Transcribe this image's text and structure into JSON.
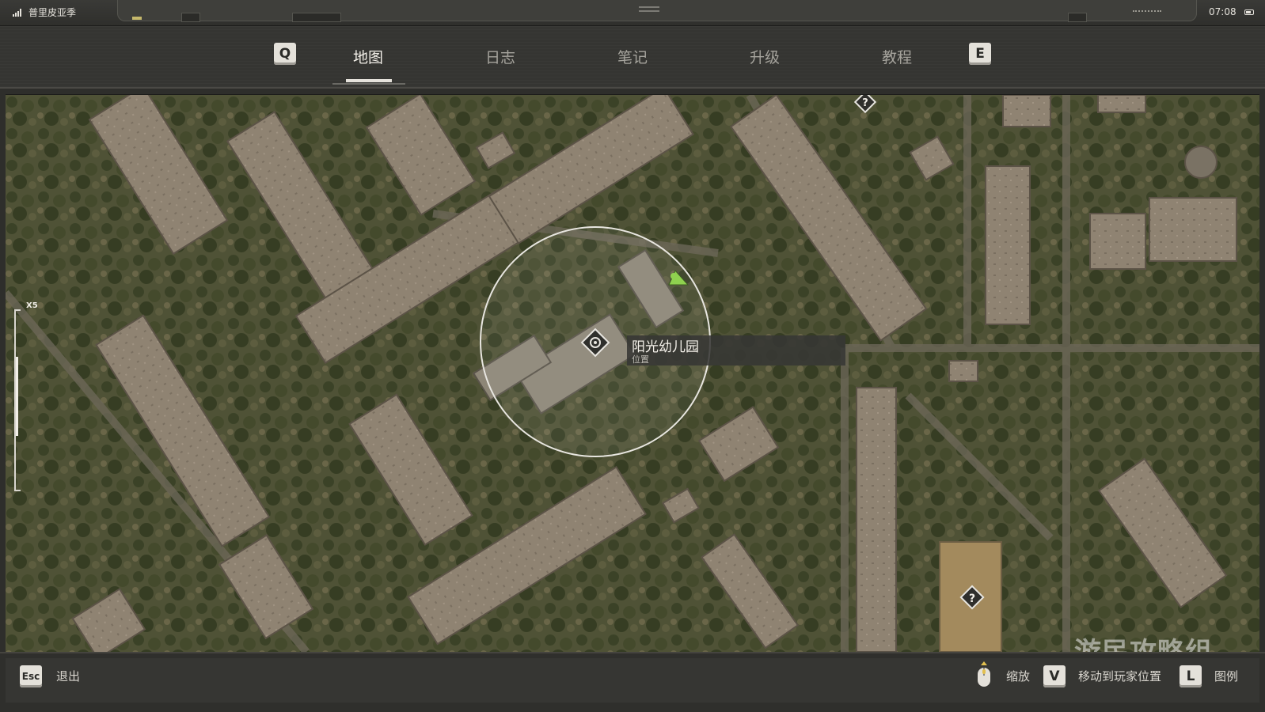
{
  "status_bar": {
    "carrier": "普里皮亚季",
    "time": "07:08"
  },
  "tabs": {
    "prev_key": "Q",
    "next_key": "E",
    "items": [
      {
        "label": "地图",
        "active": true
      },
      {
        "label": "日志",
        "active": false
      },
      {
        "label": "笔记",
        "active": false
      },
      {
        "label": "升级",
        "active": false
      },
      {
        "label": "教程",
        "active": false
      }
    ]
  },
  "map": {
    "zoom_level": "X5",
    "location": {
      "name": "阳光幼儿园",
      "type": "位置"
    },
    "unknown_marker_glyph": "?",
    "watermark": "游民攻略组"
  },
  "bottom_bar": {
    "exit_key": "Esc",
    "exit_label": "退出",
    "zoom_label": "缩放",
    "move_key": "V",
    "move_label": "移动到玩家位置",
    "legend_key": "L",
    "legend_label": "图例"
  },
  "colors": {
    "accent_player": "#8fd14f",
    "ui_text": "#d9d6cf",
    "keycap": "#e4e1da"
  }
}
